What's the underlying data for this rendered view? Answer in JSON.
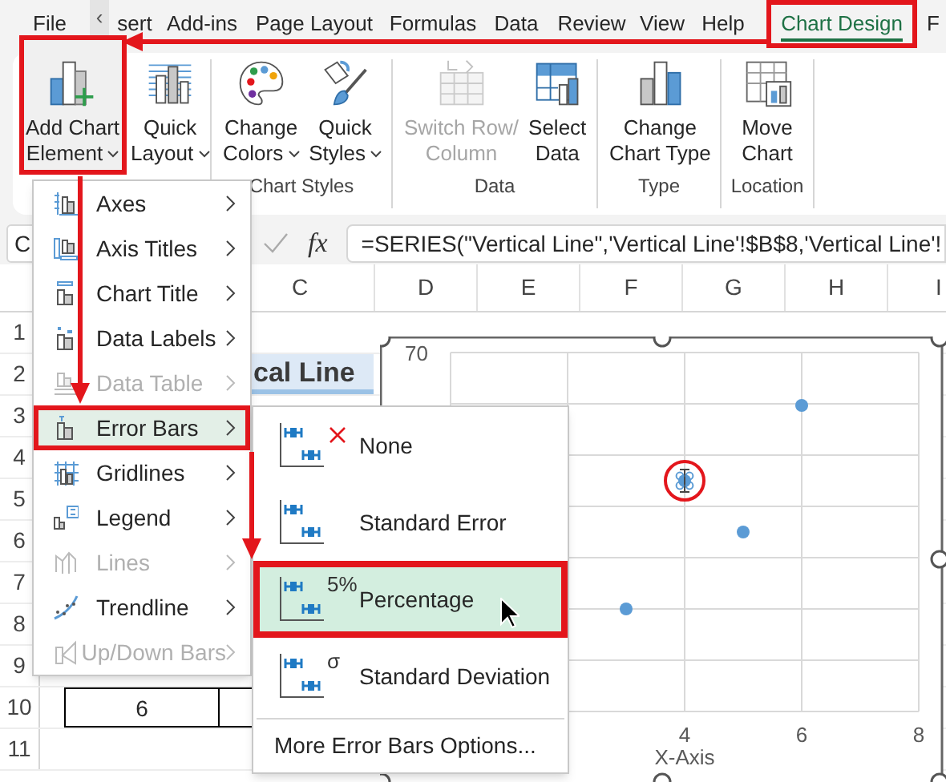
{
  "tabs": [
    {
      "label": "File",
      "selected": false,
      "highlighted": false
    },
    {
      "label": "sert",
      "selected": false,
      "highlighted": false
    },
    {
      "label": "Add-ins",
      "selected": false,
      "highlighted": false
    },
    {
      "label": "Page Layout",
      "selected": false,
      "highlighted": false
    },
    {
      "label": "Formulas",
      "selected": false,
      "highlighted": false
    },
    {
      "label": "Data",
      "selected": false,
      "highlighted": false
    },
    {
      "label": "Review",
      "selected": false,
      "highlighted": false
    },
    {
      "label": "View",
      "selected": false,
      "highlighted": false
    },
    {
      "label": "Help",
      "selected": false,
      "highlighted": false
    },
    {
      "label": "Chart Design",
      "selected": true,
      "highlighted": true
    },
    {
      "label": "F",
      "selected": false,
      "highlighted": false
    }
  ],
  "tab_scroll": "‹",
  "ribbon": {
    "groups": [
      {
        "buttons": [
          {
            "kind": "add-chart",
            "lines": [
              "Add Chart",
              "Element"
            ],
            "dropdown": true,
            "disabled": false,
            "highlighted": true
          },
          {
            "kind": "quick-layout",
            "lines": [
              "Quick",
              "Layout"
            ],
            "dropdown": true,
            "disabled": false,
            "highlighted": false
          }
        ]
      },
      {
        "label": "Chart Styles",
        "buttons": [
          {
            "kind": "colors",
            "lines": [
              "Change",
              "Colors"
            ],
            "dropdown": true,
            "disabled": false,
            "highlighted": false
          },
          {
            "kind": "styles",
            "lines": [
              "Quick",
              "Styles"
            ],
            "dropdown": true,
            "disabled": false,
            "highlighted": false
          }
        ]
      },
      {
        "label": "Data",
        "buttons": [
          {
            "kind": "switch",
            "lines": [
              "Switch Row/",
              "Column"
            ],
            "dropdown": false,
            "disabled": true,
            "highlighted": false
          },
          {
            "kind": "select-data",
            "lines": [
              "Select",
              "Data"
            ],
            "dropdown": false,
            "disabled": false,
            "highlighted": false
          }
        ]
      },
      {
        "label": "Type",
        "buttons": [
          {
            "kind": "change-type",
            "lines": [
              "Change",
              "Chart Type"
            ],
            "dropdown": false,
            "disabled": false,
            "highlighted": false
          }
        ]
      },
      {
        "label": "Location",
        "buttons": [
          {
            "kind": "move",
            "lines": [
              "Move",
              "Chart"
            ],
            "dropdown": false,
            "disabled": false,
            "highlighted": false
          }
        ]
      }
    ]
  },
  "formula_bar": {
    "name_box": "C",
    "function_label": "fx",
    "formula": "=SERIES(\"Vertical Line\",'Vertical Line'!$B$8,'Vertical Line'!"
  },
  "sheet": {
    "columns": [
      "C",
      "D",
      "E",
      "F",
      "G",
      "H",
      "I"
    ],
    "rows": [
      "1",
      "2",
      "3",
      "4",
      "5",
      "6",
      "7",
      "8",
      "9",
      "10",
      "11"
    ],
    "cells": [
      {
        "kind": "title",
        "text": "cal Line"
      },
      {
        "kind": "value",
        "text": "6"
      }
    ]
  },
  "chart": {
    "y_axis_label": "70",
    "x_axis_labels": [
      "4",
      "6",
      "8"
    ],
    "x_axis_title": "X-Axis",
    "gridlines": true,
    "points": [
      {
        "selected": false
      },
      {
        "selected": true
      },
      {
        "selected": false
      },
      {
        "selected": false
      }
    ]
  },
  "menu": {
    "items": [
      {
        "kind": "axes",
        "label": "Axes",
        "disabled": false,
        "selected": false,
        "highlighted": false
      },
      {
        "kind": "axis-titles",
        "label": "Axis Titles",
        "disabled": false,
        "selected": false,
        "highlighted": false
      },
      {
        "kind": "chart-title",
        "label": "Chart Title",
        "disabled": false,
        "selected": false,
        "highlighted": false
      },
      {
        "kind": "data-labels",
        "label": "Data Labels",
        "disabled": false,
        "selected": false,
        "highlighted": false
      },
      {
        "kind": "data-table",
        "label": "Data Table",
        "disabled": true,
        "selected": false,
        "highlighted": false
      },
      {
        "kind": "error-bars",
        "label": "Error Bars",
        "disabled": false,
        "selected": true,
        "highlighted": true
      },
      {
        "kind": "gridlines",
        "label": "Gridlines",
        "disabled": false,
        "selected": false,
        "highlighted": false
      },
      {
        "kind": "legend",
        "label": "Legend",
        "disabled": false,
        "selected": false,
        "highlighted": false
      },
      {
        "kind": "lines",
        "label": "Lines",
        "disabled": true,
        "selected": false,
        "highlighted": false
      },
      {
        "kind": "trendline",
        "label": "Trendline",
        "disabled": false,
        "selected": false,
        "highlighted": false
      },
      {
        "kind": "updown",
        "label": "Up/Down Bars",
        "disabled": true,
        "selected": false,
        "highlighted": false
      }
    ]
  },
  "submenu": {
    "items": [
      {
        "kind": "none",
        "label": "None",
        "selected": false,
        "highlighted": false
      },
      {
        "kind": "plain",
        "label": "Standard Error",
        "selected": false,
        "highlighted": false
      },
      {
        "kind": "badge",
        "badge": "5%",
        "label": "Percentage",
        "selected": true,
        "highlighted": true
      },
      {
        "kind": "badge",
        "badge": "σ",
        "label": "Standard Deviation",
        "selected": false,
        "highlighted": false
      }
    ],
    "more": "More Error Bars Options..."
  },
  "annotation_arrows": true,
  "mouse_cursor": true
}
